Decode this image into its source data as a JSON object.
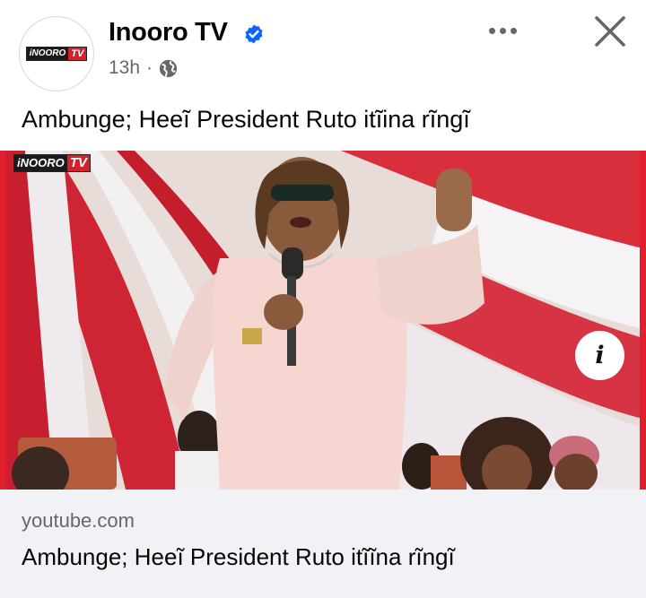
{
  "header": {
    "page_name": "Inooro TV",
    "time": "13h",
    "separator": "·",
    "avatar_logo": {
      "left": "iNOORO",
      "right": "TV"
    },
    "icons": {
      "verified": "verified-badge-icon",
      "audience": "globe-icon",
      "more": "more-options-icon",
      "close": "close-icon"
    }
  },
  "post": {
    "text": "Ambunge; Heeĩ President Ruto itĩina rĩngĩ"
  },
  "media": {
    "watermark": {
      "left": "iNOORO",
      "right": "TV"
    },
    "info_label": "i"
  },
  "link_preview": {
    "domain": "youtube.com",
    "title": "Ambunge; Heeĩ President Ruto itĩĩna rĩngĩ"
  },
  "colors": {
    "verified_blue": "#0866ff",
    "secondary_text": "#65676b",
    "preview_bg": "#f0f2f5",
    "brand_red": "#d0232b"
  }
}
